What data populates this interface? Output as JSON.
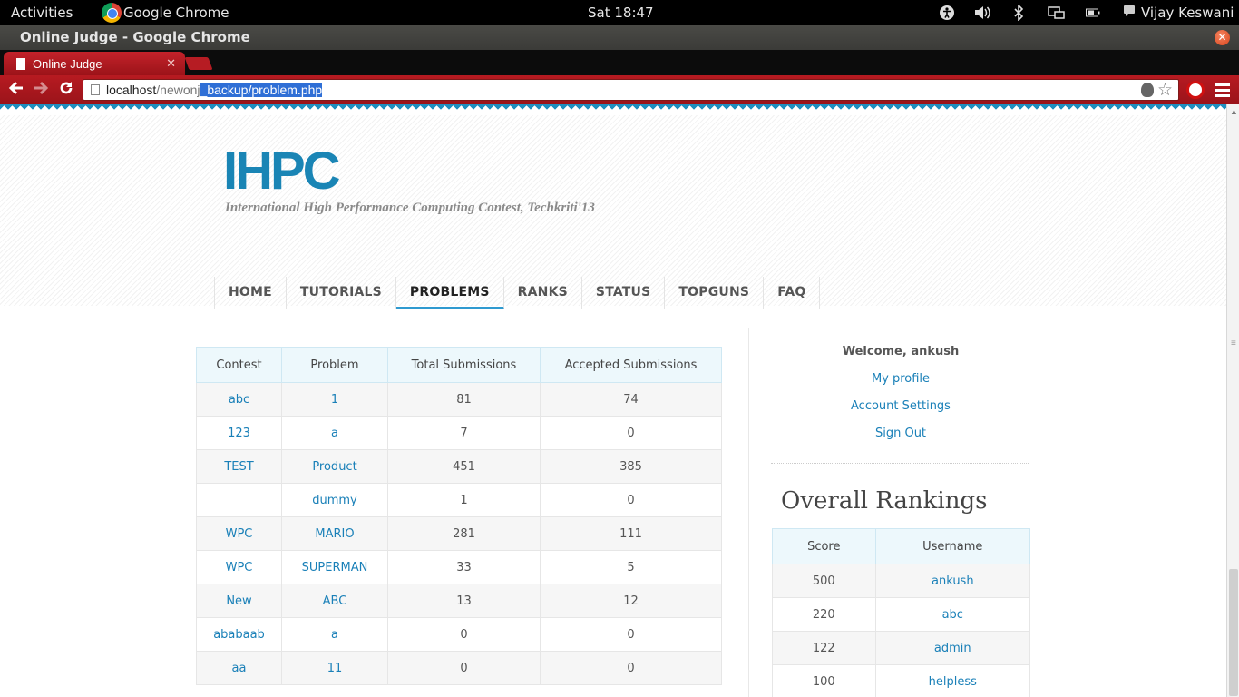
{
  "system_bar": {
    "activities": "Activities",
    "app_name": "Google Chrome",
    "clock": "Sat 18:47",
    "user": "Vijay Keswani"
  },
  "window": {
    "title": "Online Judge - Google Chrome"
  },
  "browser": {
    "tab_title": "Online Judge",
    "url_host": "localhost",
    "url_path_dim": "/newonj",
    "url_path_selected": "_backup/problem.php"
  },
  "site": {
    "logo": "IHPC",
    "tagline": "International High Performance Computing Contest, Techkriti'13",
    "nav": [
      "HOME",
      "TUTORIALS",
      "PROBLEMS",
      "RANKS",
      "STATUS",
      "TOPGUNS",
      "FAQ"
    ],
    "active_nav": "PROBLEMS"
  },
  "problems_table": {
    "headers": [
      "Contest",
      "Problem",
      "Total Submissions",
      "Accepted Submissions"
    ],
    "rows": [
      {
        "contest": "abc",
        "problem": "1",
        "total": "81",
        "accepted": "74"
      },
      {
        "contest": "123",
        "problem": "a",
        "total": "7",
        "accepted": "0"
      },
      {
        "contest": "TEST",
        "problem": "Product",
        "total": "451",
        "accepted": "385"
      },
      {
        "contest": "",
        "problem": "dummy",
        "total": "1",
        "accepted": "0"
      },
      {
        "contest": "WPC",
        "problem": "MARIO",
        "total": "281",
        "accepted": "111"
      },
      {
        "contest": "WPC",
        "problem": "SUPERMAN",
        "total": "33",
        "accepted": "5"
      },
      {
        "contest": "New",
        "problem": "ABC",
        "total": "13",
        "accepted": "12"
      },
      {
        "contest": "ababaab",
        "problem": "a",
        "total": "0",
        "accepted": "0"
      },
      {
        "contest": "aa",
        "problem": "11",
        "total": "0",
        "accepted": "0"
      }
    ]
  },
  "sidebar": {
    "welcome": "Welcome, ankush",
    "links": [
      "My profile",
      "Account Settings",
      "Sign Out"
    ],
    "rankings_title": "Overall Rankings",
    "rankings_headers": [
      "Score",
      "Username"
    ],
    "rankings": [
      {
        "score": "500",
        "username": "ankush"
      },
      {
        "score": "220",
        "username": "abc"
      },
      {
        "score": "122",
        "username": "admin"
      },
      {
        "score": "100",
        "username": "helpless"
      }
    ]
  },
  "colors": {
    "brand_blue": "#1a85b5",
    "link_blue": "#1a80b8",
    "chrome_red": "#b71a21",
    "table_header_bg": "#edf8fc"
  }
}
